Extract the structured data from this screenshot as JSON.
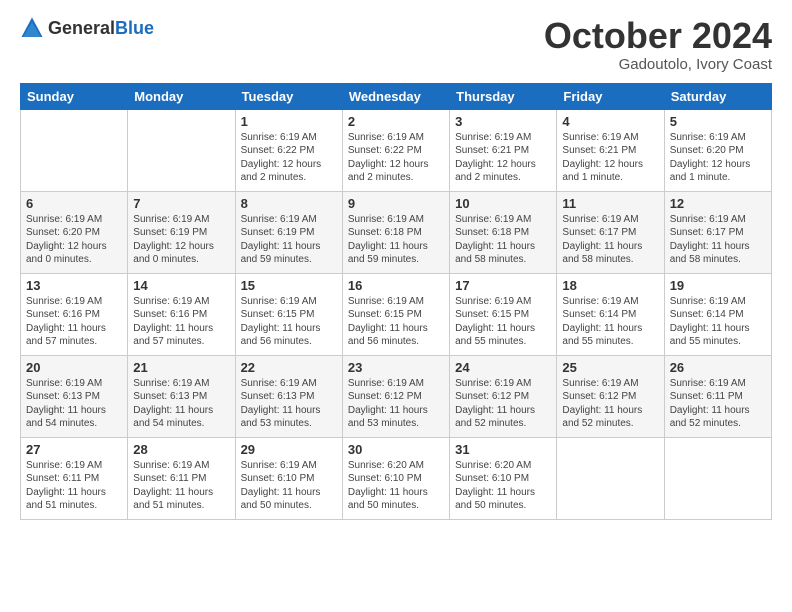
{
  "header": {
    "logo_general": "General",
    "logo_blue": "Blue",
    "month_title": "October 2024",
    "subtitle": "Gadoutolo, Ivory Coast"
  },
  "days_of_week": [
    "Sunday",
    "Monday",
    "Tuesday",
    "Wednesday",
    "Thursday",
    "Friday",
    "Saturday"
  ],
  "weeks": [
    [
      {
        "day": "",
        "info": ""
      },
      {
        "day": "",
        "info": ""
      },
      {
        "day": "1",
        "info": "Sunrise: 6:19 AM\nSunset: 6:22 PM\nDaylight: 12 hours and 2 minutes."
      },
      {
        "day": "2",
        "info": "Sunrise: 6:19 AM\nSunset: 6:22 PM\nDaylight: 12 hours and 2 minutes."
      },
      {
        "day": "3",
        "info": "Sunrise: 6:19 AM\nSunset: 6:21 PM\nDaylight: 12 hours and 2 minutes."
      },
      {
        "day": "4",
        "info": "Sunrise: 6:19 AM\nSunset: 6:21 PM\nDaylight: 12 hours and 1 minute."
      },
      {
        "day": "5",
        "info": "Sunrise: 6:19 AM\nSunset: 6:20 PM\nDaylight: 12 hours and 1 minute."
      }
    ],
    [
      {
        "day": "6",
        "info": "Sunrise: 6:19 AM\nSunset: 6:20 PM\nDaylight: 12 hours and 0 minutes."
      },
      {
        "day": "7",
        "info": "Sunrise: 6:19 AM\nSunset: 6:19 PM\nDaylight: 12 hours and 0 minutes."
      },
      {
        "day": "8",
        "info": "Sunrise: 6:19 AM\nSunset: 6:19 PM\nDaylight: 11 hours and 59 minutes."
      },
      {
        "day": "9",
        "info": "Sunrise: 6:19 AM\nSunset: 6:18 PM\nDaylight: 11 hours and 59 minutes."
      },
      {
        "day": "10",
        "info": "Sunrise: 6:19 AM\nSunset: 6:18 PM\nDaylight: 11 hours and 58 minutes."
      },
      {
        "day": "11",
        "info": "Sunrise: 6:19 AM\nSunset: 6:17 PM\nDaylight: 11 hours and 58 minutes."
      },
      {
        "day": "12",
        "info": "Sunrise: 6:19 AM\nSunset: 6:17 PM\nDaylight: 11 hours and 58 minutes."
      }
    ],
    [
      {
        "day": "13",
        "info": "Sunrise: 6:19 AM\nSunset: 6:16 PM\nDaylight: 11 hours and 57 minutes."
      },
      {
        "day": "14",
        "info": "Sunrise: 6:19 AM\nSunset: 6:16 PM\nDaylight: 11 hours and 57 minutes."
      },
      {
        "day": "15",
        "info": "Sunrise: 6:19 AM\nSunset: 6:15 PM\nDaylight: 11 hours and 56 minutes."
      },
      {
        "day": "16",
        "info": "Sunrise: 6:19 AM\nSunset: 6:15 PM\nDaylight: 11 hours and 56 minutes."
      },
      {
        "day": "17",
        "info": "Sunrise: 6:19 AM\nSunset: 6:15 PM\nDaylight: 11 hours and 55 minutes."
      },
      {
        "day": "18",
        "info": "Sunrise: 6:19 AM\nSunset: 6:14 PM\nDaylight: 11 hours and 55 minutes."
      },
      {
        "day": "19",
        "info": "Sunrise: 6:19 AM\nSunset: 6:14 PM\nDaylight: 11 hours and 55 minutes."
      }
    ],
    [
      {
        "day": "20",
        "info": "Sunrise: 6:19 AM\nSunset: 6:13 PM\nDaylight: 11 hours and 54 minutes."
      },
      {
        "day": "21",
        "info": "Sunrise: 6:19 AM\nSunset: 6:13 PM\nDaylight: 11 hours and 54 minutes."
      },
      {
        "day": "22",
        "info": "Sunrise: 6:19 AM\nSunset: 6:13 PM\nDaylight: 11 hours and 53 minutes."
      },
      {
        "day": "23",
        "info": "Sunrise: 6:19 AM\nSunset: 6:12 PM\nDaylight: 11 hours and 53 minutes."
      },
      {
        "day": "24",
        "info": "Sunrise: 6:19 AM\nSunset: 6:12 PM\nDaylight: 11 hours and 52 minutes."
      },
      {
        "day": "25",
        "info": "Sunrise: 6:19 AM\nSunset: 6:12 PM\nDaylight: 11 hours and 52 minutes."
      },
      {
        "day": "26",
        "info": "Sunrise: 6:19 AM\nSunset: 6:11 PM\nDaylight: 11 hours and 52 minutes."
      }
    ],
    [
      {
        "day": "27",
        "info": "Sunrise: 6:19 AM\nSunset: 6:11 PM\nDaylight: 11 hours and 51 minutes."
      },
      {
        "day": "28",
        "info": "Sunrise: 6:19 AM\nSunset: 6:11 PM\nDaylight: 11 hours and 51 minutes."
      },
      {
        "day": "29",
        "info": "Sunrise: 6:19 AM\nSunset: 6:10 PM\nDaylight: 11 hours and 50 minutes."
      },
      {
        "day": "30",
        "info": "Sunrise: 6:20 AM\nSunset: 6:10 PM\nDaylight: 11 hours and 50 minutes."
      },
      {
        "day": "31",
        "info": "Sunrise: 6:20 AM\nSunset: 6:10 PM\nDaylight: 11 hours and 50 minutes."
      },
      {
        "day": "",
        "info": ""
      },
      {
        "day": "",
        "info": ""
      }
    ]
  ]
}
